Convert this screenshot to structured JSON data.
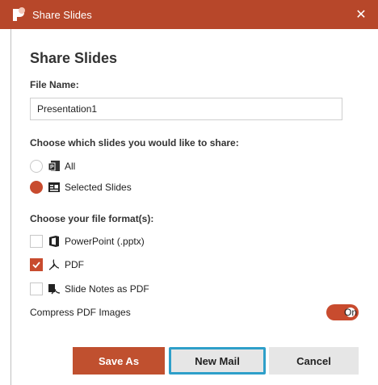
{
  "window": {
    "title": "Share Slides",
    "close_symbol": "✕",
    "accent_color": "#b7472a"
  },
  "heading": "Share Slides",
  "file_name": {
    "label": "File Name:",
    "value": "Presentation1"
  },
  "slides": {
    "label": "Choose which slides you would like to share:",
    "options": [
      {
        "label": "All",
        "icon": "powerpoint-slides-icon",
        "selected": false
      },
      {
        "label": "Selected Slides",
        "icon": "selected-slides-icon",
        "selected": true
      }
    ]
  },
  "formats": {
    "label": "Choose your file format(s):",
    "options": [
      {
        "label": "PowerPoint (.pptx)",
        "icon": "office-icon",
        "checked": false
      },
      {
        "label": "PDF",
        "icon": "pdf-icon",
        "checked": true
      },
      {
        "label": "Slide Notes as PDF",
        "icon": "notes-pdf-icon",
        "checked": false
      }
    ]
  },
  "compress": {
    "label": "Compress PDF Images",
    "state_label": "On",
    "on": true
  },
  "buttons": {
    "save_as": "Save As",
    "new_mail": "New Mail",
    "cancel": "Cancel"
  }
}
